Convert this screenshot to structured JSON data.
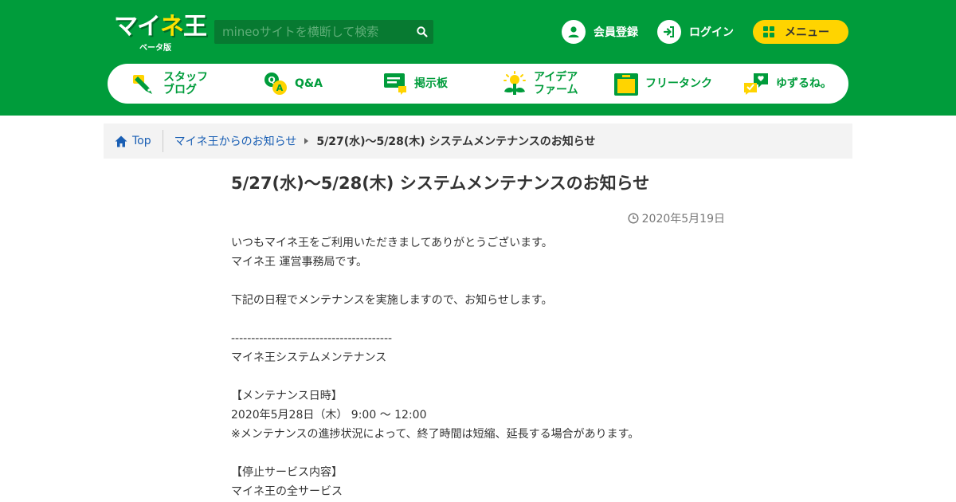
{
  "header": {
    "logo": {
      "main_a": "マイ",
      "main_b": "ネ",
      "main_c": "王",
      "sub": "ベータ版"
    },
    "search": {
      "placeholder": "mineoサイトを横断して検索",
      "value": ""
    },
    "register_label": "会員登録",
    "login_label": "ログイン",
    "menu_label": "メニュー",
    "colors": {
      "brand_green": "#009c3b",
      "accent_yellow": "#ffd400"
    }
  },
  "nav": {
    "items": [
      {
        "label_line1": "スタッフ",
        "label_line2": "ブログ",
        "icon": "pen-icon"
      },
      {
        "label_line1": "Q&A",
        "label_line2": "",
        "icon": "qa-icon"
      },
      {
        "label_line1": "掲示板",
        "label_line2": "",
        "icon": "chat-bubble-icon"
      },
      {
        "label_line1": "アイデア",
        "label_line2": "ファーム",
        "icon": "lightbulb-icon"
      },
      {
        "label_line1": "フリータンク",
        "label_line2": "",
        "icon": "tank-icon"
      },
      {
        "label_line1": "ゆずるね。",
        "label_line2": "",
        "icon": "heart-bubble-icon"
      }
    ]
  },
  "breadcrumb": {
    "home": "Top",
    "parent": "マイネ王からのお知らせ",
    "current": "5/27(水)～5/28(木) システムメンテナンスのお知らせ"
  },
  "article": {
    "title": "5/27(水)～5/28(木) システムメンテナンスのお知らせ",
    "date": "2020年5月19日",
    "lines": [
      "いつもマイネ王をご利用いただきましてありがとうございます。",
      "マイネ王 運営事務局です。",
      "",
      "下記の日程でメンテナンスを実施しますので、お知らせします。",
      "",
      "----------------------------------------",
      "マイネ王システムメンテナンス",
      "",
      "【メンテナンス日時】",
      "2020年5月28日（木） 9:00 ～ 12:00",
      "※メンテナンスの進捗状況によって、終了時間は短縮、延長する場合があります。",
      "",
      "【停止サービス内容】",
      "マイネ王の全サービス"
    ]
  }
}
